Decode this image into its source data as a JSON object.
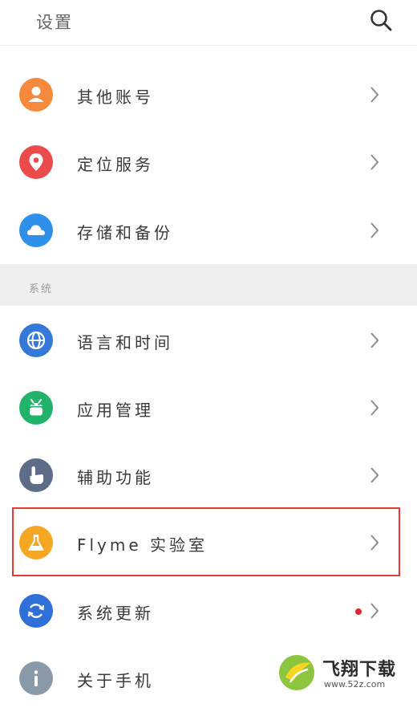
{
  "header": {
    "title": "设置",
    "search_icon": "search-icon"
  },
  "accounts": [
    {
      "label": "其他账号",
      "icon": "person-icon",
      "color": "#f58a3c"
    },
    {
      "label": "定位服务",
      "icon": "location-pin-icon",
      "color": "#ec4b4b"
    },
    {
      "label": "存储和备份",
      "icon": "cloud-icon",
      "color": "#2e90e8"
    }
  ],
  "section": {
    "title": "系统"
  },
  "system": [
    {
      "label": "语言和时间",
      "icon": "globe-icon",
      "color": "#3479d8"
    },
    {
      "label": "应用管理",
      "icon": "android-icon",
      "color": "#21b36a"
    },
    {
      "label": "辅助功能",
      "icon": "hand-pointer-icon",
      "color": "#5d6d88"
    },
    {
      "label": "Flyme 实验室",
      "icon": "flask-icon",
      "color": "#f5a623"
    },
    {
      "label": "系统更新",
      "icon": "refresh-icon",
      "color": "#2f6fd8",
      "badge": "red-dot"
    },
    {
      "label": "关于手机",
      "icon": "info-icon",
      "color": "#8a99a8"
    }
  ],
  "watermark": {
    "brand": "飞翔下载",
    "url": "www.52z.com"
  }
}
